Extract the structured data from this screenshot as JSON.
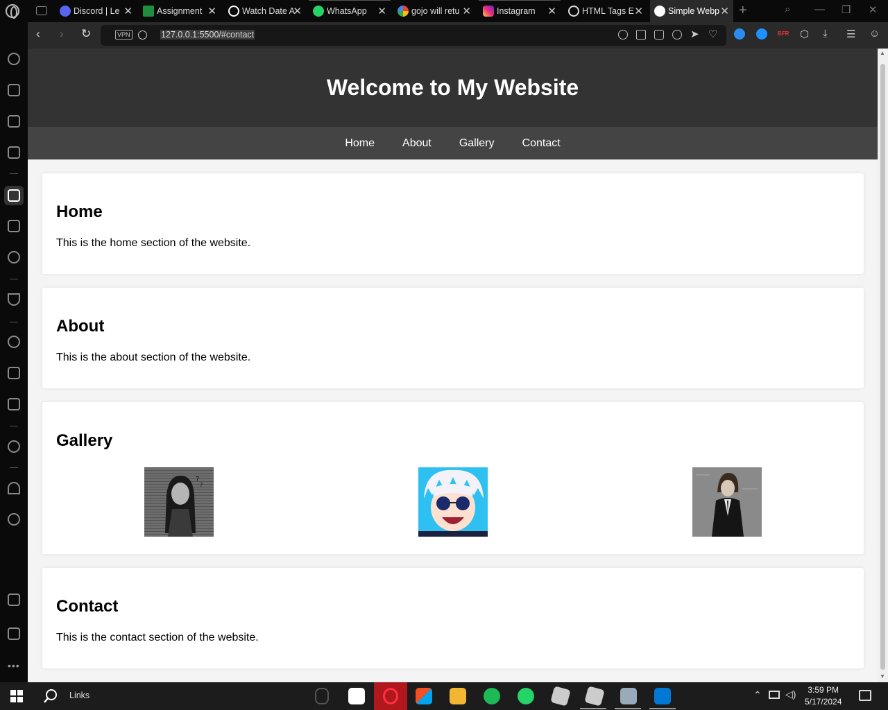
{
  "browser": {
    "tabs": [
      {
        "label": "Discord | Le",
        "favicon": "discord-icon",
        "color": "#5865F2"
      },
      {
        "label": "Assignment",
        "favicon": "classroom-icon",
        "color": "#1e8e3e"
      },
      {
        "label": "Watch Date A",
        "favicon": "watch-icon",
        "color": "#ffffff"
      },
      {
        "label": "WhatsApp",
        "favicon": "whatsapp-icon",
        "color": "#25D366"
      },
      {
        "label": "gojo will retu",
        "favicon": "google-icon",
        "color": "#ffffff"
      },
      {
        "label": "Instagram",
        "favicon": "instagram-icon",
        "color": "#e1306c"
      },
      {
        "label": "HTML Tags E",
        "favicon": "chatgpt-icon",
        "color": "#ffffff"
      },
      {
        "label": "Simple Webp",
        "favicon": "globe-icon",
        "color": "#ffffff"
      }
    ],
    "url": "127.0.0.1:5500/#contact",
    "vpn_label": "VPN",
    "ext_label": "BFR"
  },
  "page": {
    "title": "Welcome to My Website",
    "nav": [
      "Home",
      "About",
      "Gallery",
      "Contact"
    ],
    "sections": {
      "home": {
        "heading": "Home",
        "text": "This is the home section of the website."
      },
      "about": {
        "heading": "About",
        "text": "This is the about section of the website."
      },
      "gallery": {
        "heading": "Gallery"
      },
      "contact": {
        "heading": "Contact",
        "text": "This is the contact section of the website."
      }
    }
  },
  "taskbar": {
    "search_label": "Links",
    "time": "3:59 PM",
    "date": "5/17/2024"
  }
}
